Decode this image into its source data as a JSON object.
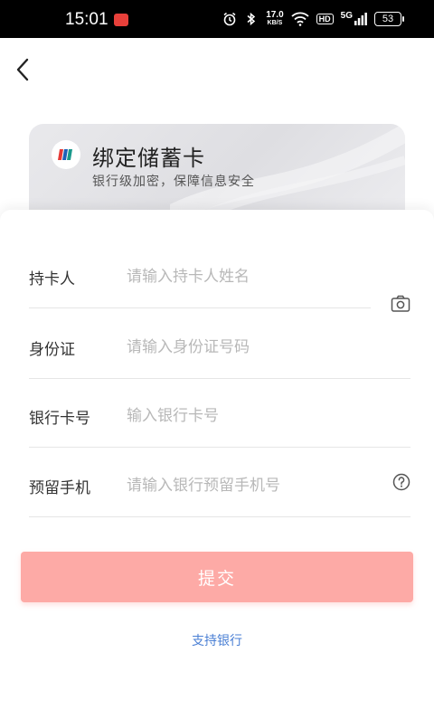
{
  "status_bar": {
    "time": "15:01",
    "net_speed_value": "17.0",
    "net_speed_unit": "KB/S",
    "hd_label": "HD",
    "signal_label": "5G",
    "battery": "53"
  },
  "card": {
    "title": "绑定储蓄卡",
    "subtitle": "银行级加密，保障信息安全"
  },
  "form": {
    "fields": [
      {
        "label": "持卡人",
        "placeholder": "请输入持卡人姓名",
        "value": ""
      },
      {
        "label": "身份证",
        "placeholder": "请输入身份证号码",
        "value": ""
      },
      {
        "label": "银行卡号",
        "placeholder": "输入银行卡号",
        "value": ""
      },
      {
        "label": "预留手机",
        "placeholder": "请输入银行预留手机号",
        "value": ""
      }
    ]
  },
  "actions": {
    "submit_label": "提交",
    "support_banks_label": "支持银行"
  },
  "colors": {
    "submit_bg": "#fdaaa6",
    "link": "#4a7fd4",
    "status_bar_bg": "#000000"
  },
  "icons": {
    "back": "chevron-left-icon",
    "camera": "camera-icon",
    "help": "question-circle-icon"
  }
}
